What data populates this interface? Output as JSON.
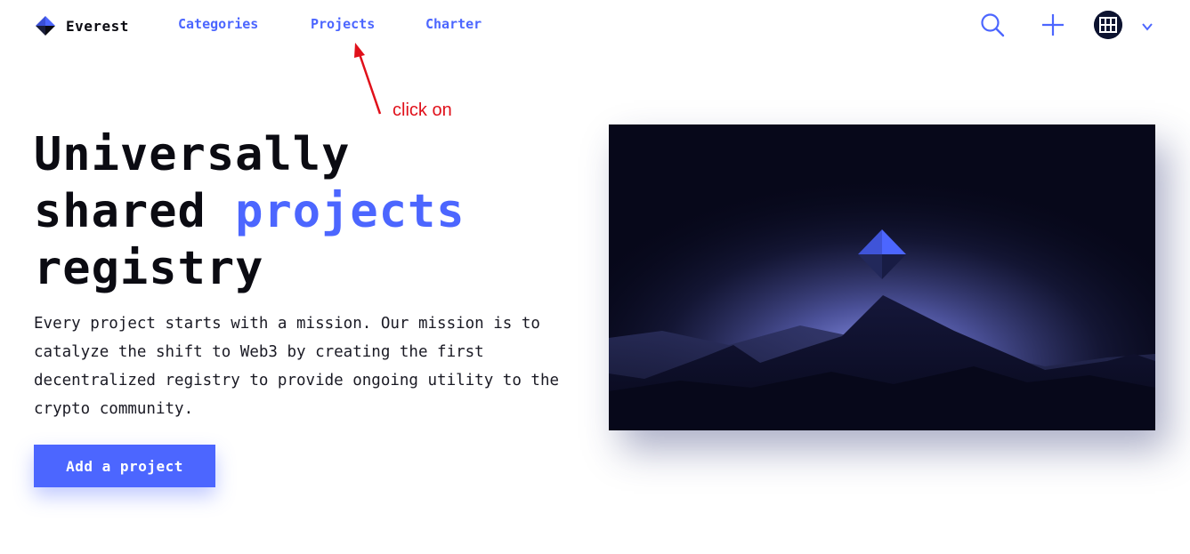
{
  "brand": {
    "name": "Everest"
  },
  "nav": {
    "categories": "Categories",
    "projects": "Projects",
    "charter": "Charter"
  },
  "header_icons": {
    "search": "search-icon",
    "add": "plus-icon",
    "avatar": "user-avatar",
    "menu": "chevron-down-icon"
  },
  "annotation": {
    "text": "click on"
  },
  "hero": {
    "title_line1": "Universally",
    "title_line2_prefix": "shared ",
    "title_line2_accent": "projects",
    "title_line3": "registry",
    "description": "Every project starts with a mission. Our mission is to catalyze the shift to Web3 by creating the first decentralized registry to provide ongoing utility to the crypto community.",
    "cta_label": "Add a project"
  },
  "colors": {
    "accent": "#4c66ff",
    "text": "#0b0b12",
    "annotation": "#e0101a",
    "image_background": "#07081a"
  }
}
